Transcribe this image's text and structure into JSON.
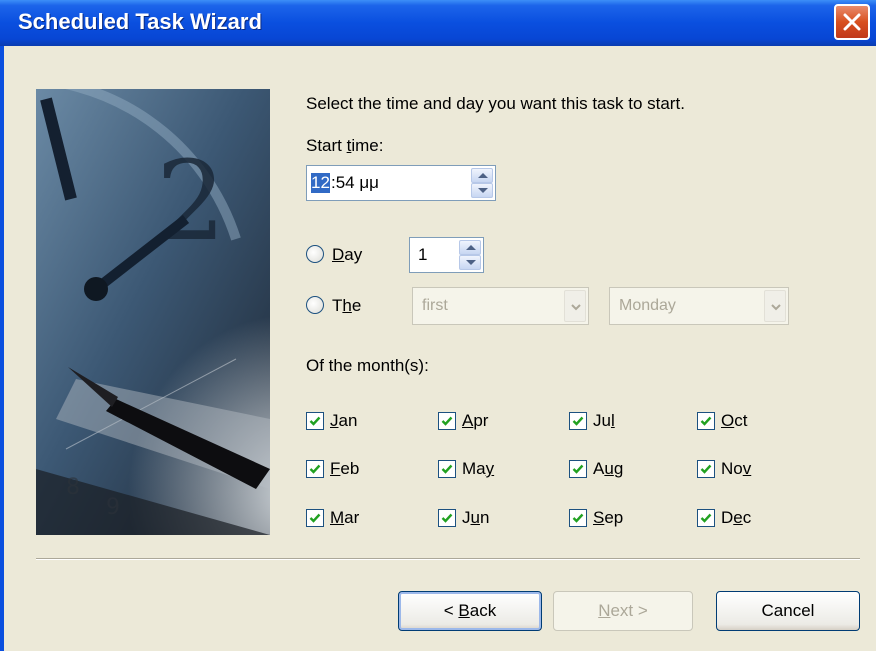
{
  "window": {
    "title": "Scheduled Task Wizard"
  },
  "colors": {
    "titlebar": "#0a4fdf",
    "dialog_bg": "#ece9d8",
    "close_button": "#d8501f",
    "check": "#21a121"
  },
  "icons": {
    "close": "close-icon",
    "picture": "clock-and-pen-illustration",
    "check": "checkmark-icon"
  },
  "instruction": "Select the time and day you want this task to start.",
  "start_time": {
    "label_pre": "Start ",
    "label_u": "t",
    "label_post": "ime:",
    "hour": "12",
    "rest": ":54 μμ"
  },
  "day_option": {
    "label_u": "D",
    "label_post": "ay",
    "value": "1",
    "selected": false
  },
  "the_option": {
    "label_pre": "T",
    "label_u": "h",
    "label_post": "e",
    "selected": false,
    "week_value": "first",
    "weekday_value": "Monday"
  },
  "months_label": "Of the month(s):",
  "months": [
    {
      "pre": "",
      "u": "J",
      "post": "an",
      "checked": true
    },
    {
      "pre": "",
      "u": "A",
      "post": "pr",
      "checked": true
    },
    {
      "pre": "Ju",
      "u": "l",
      "post": "",
      "checked": true
    },
    {
      "pre": "",
      "u": "O",
      "post": "ct",
      "checked": true
    },
    {
      "pre": "",
      "u": "F",
      "post": "eb",
      "checked": true
    },
    {
      "pre": "Ma",
      "u": "y",
      "post": "",
      "checked": true
    },
    {
      "pre": "A",
      "u": "u",
      "post": "g",
      "checked": true
    },
    {
      "pre": "No",
      "u": "v",
      "post": "",
      "checked": true
    },
    {
      "pre": "",
      "u": "M",
      "post": "ar",
      "checked": true
    },
    {
      "pre": "J",
      "u": "u",
      "post": "n",
      "checked": true
    },
    {
      "pre": "",
      "u": "S",
      "post": "ep",
      "checked": true
    },
    {
      "pre": "D",
      "u": "e",
      "post": "c",
      "checked": true
    }
  ],
  "buttons": {
    "back": {
      "pre": "< ",
      "u": "B",
      "post": "ack"
    },
    "next": {
      "pre": "",
      "u": "N",
      "post": "ext >"
    },
    "cancel": "Cancel"
  }
}
